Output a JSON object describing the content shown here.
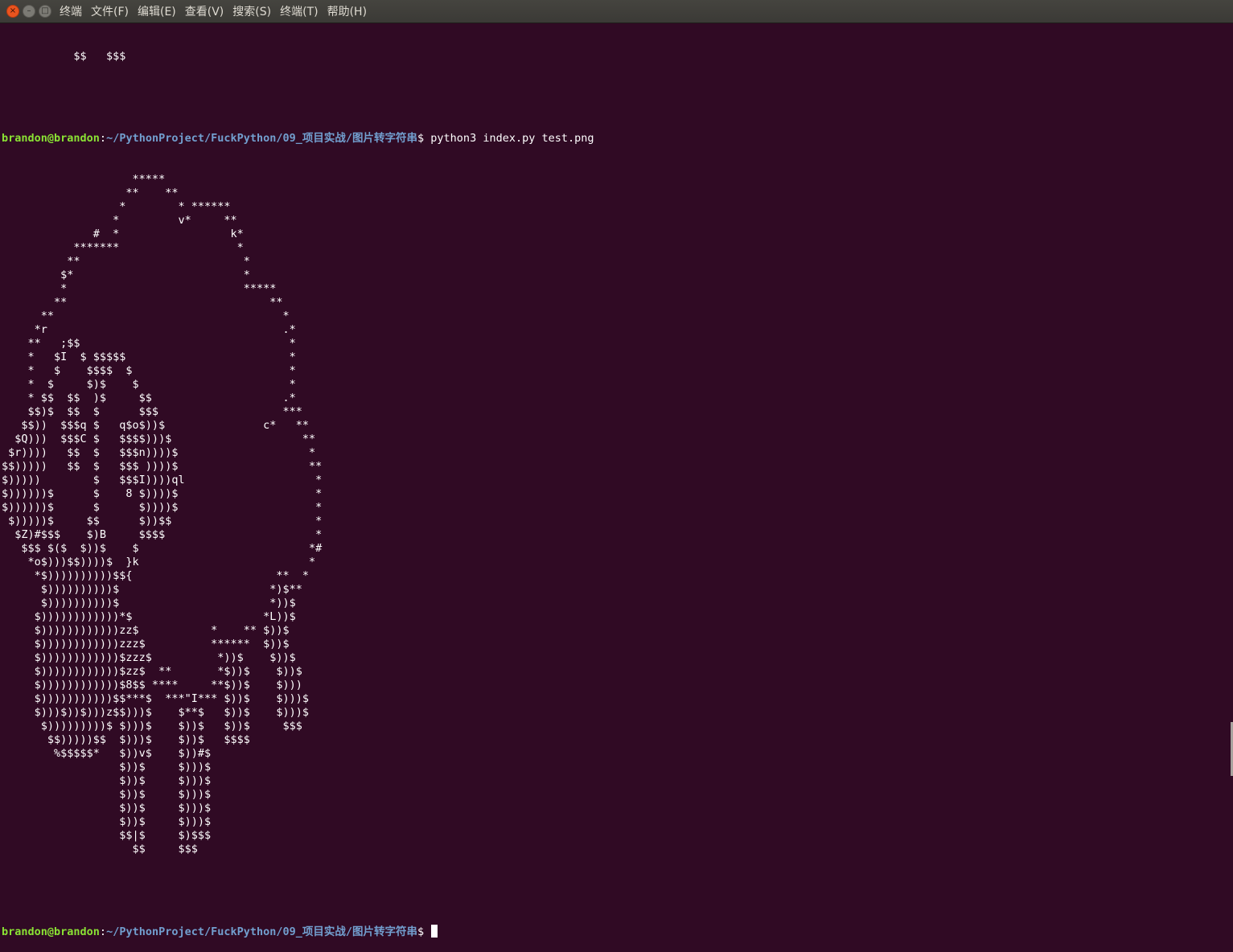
{
  "window": {
    "buttons": {
      "close": "×",
      "minimize": "–",
      "maximize": "□"
    }
  },
  "menu": [
    "终端",
    "文件(F)",
    "编辑(E)",
    "查看(V)",
    "搜索(S)",
    "终端(T)",
    "帮助(H)"
  ],
  "terminal": {
    "top_fragment": "           $$   $$$",
    "prompt": {
      "user": "brandon@brandon",
      "colon": ":",
      "path": "~/PythonProject/FuckPython/09_项目实战/图片转字符串",
      "symbol": "$ "
    },
    "command": "python3 index.py test.png",
    "ascii_art": "                    *****\n                   **    **\n                  *        * ******\n                 *         v*     **\n              #  *                 k*\n           *******                  *\n          **                         *\n         $*                          *\n         *                           *****\n        **                               **\n      **                                   *\n     *r                                    .*\n    **   ;$$                                *\n    *   $I  $ $$$$$                         *\n    *   $    $$$$  $                        *\n    *  $     $)$    $                       *\n    * $$  $$  )$     $$                    .*\n    $$)$  $$  $      $$$                   ***\n   $$))  $$$q $   q$o$))$               c*   **\n  $Q)))  $$$C $   $$$$)))$                    **\n $r))))   $$  $   $$$n))))$                    *\n$$)))))   $$  $   $$$ ))))$                    **\n$)))))        $   $$$I))))ql                    *\n$))))))$      $    8 $))))$                     *\n$))))))$      $      $))))$                     *\n $)))))$     $$      $))$$                      *\n  $Z)#$$$    $)B     $$$$                       *\n   $$$ $($  $))$    $                          *#\n    *o$)))$$))))$  }k                          *\n     *$))))))))))$${                      **  *\n      $))))))))))$                       *)$**\n      $))))))))))$                       *))$\n     $))))))))))))*$                    *L))$\n     $))))))))))))zz$           *    ** $))$\n     $))))))))))))zzz$          ******  $))$\n     $))))))))))))$zzz$          *))$    $))$\n     $))))))))))))$zz$  **       *$))$    $))$\n     $))))))))))))$8$$ ****     **$))$    $)))\n     $)))))))))))$$***$  ***\"I*** $))$    $)))$\n     $)))$))$)))z$$)))$    $**$   $))$    $)))$\n      $)))))))))$ $)))$    $))$   $))$     $$$\n       $$)))))$$  $)))$    $))$   $$$$\n        %$$$$$*   $))v$    $))#$\n                  $))$     $)))$\n                  $))$     $)))$\n                  $))$     $)))$\n                  $))$     $)))$\n                  $))$     $)))$\n                  $$|$     $)$$$\n                    $$     $$$"
  }
}
